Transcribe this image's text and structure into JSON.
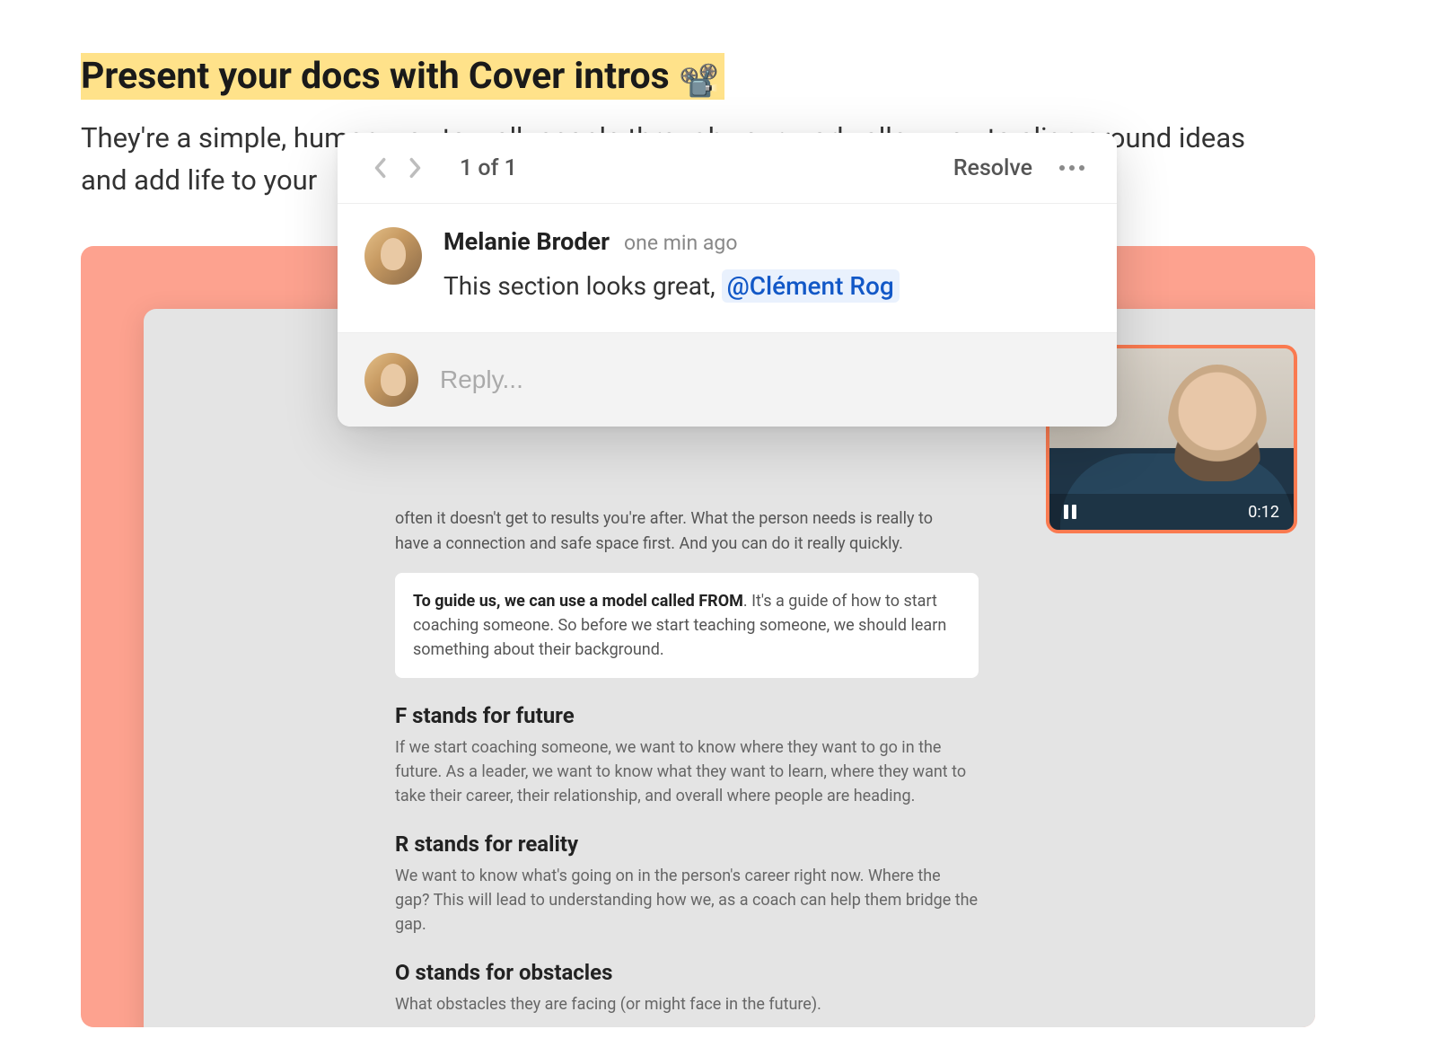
{
  "headline": {
    "text": "Present your docs with Cover intros",
    "emoji": "📽️"
  },
  "subhead": "They're a simple, human way to walk people through your work, allow you to align around ideas and add life to your",
  "comment_popover": {
    "counter": "1 of 1",
    "resolve_label": "Resolve",
    "author": "Melanie Broder",
    "timestamp": "one min ago",
    "body_text": "This section looks great, ",
    "mention": "@Clément Rog",
    "reply_placeholder": "Reply..."
  },
  "video": {
    "timestamp": "0:12"
  },
  "doc": {
    "intro_tail": "often it doesn't get to results you're after. What the person needs is really to have a connection and safe space first. And you can do it really quickly.",
    "callout_bold": "To guide us, we can use a model called FROM",
    "callout_rest": ". It's a guide of how to start coaching someone. So before we start teaching someone, we should learn something about their background.",
    "sections": [
      {
        "h": "F stands for future",
        "p": "If we start coaching someone, we want to know where they want to go in the future. As a leader, we want to know what they want to learn, where they want to take their career, their relationship, and overall where people are heading."
      },
      {
        "h": "R stands for reality",
        "p": "We want to know what's going on in the person's career right now. Where the gap? This will lead to understanding how we, as a coach can help them bridge the gap."
      },
      {
        "h": "O stands for obstacles",
        "p": "What obstacles they are facing (or might face in the future)."
      }
    ]
  }
}
